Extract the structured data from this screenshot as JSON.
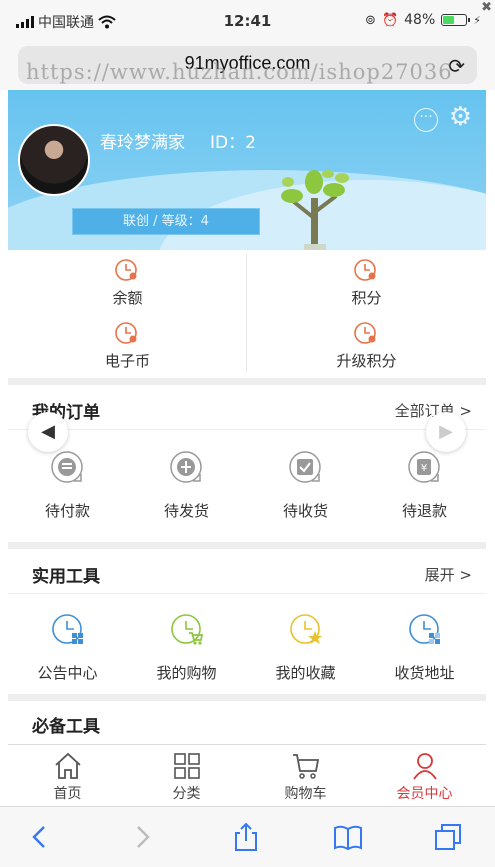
{
  "status_bar": {
    "carrier": "中国联通",
    "time": "12:41",
    "battery_percent": "48%",
    "battery_level": 0.48
  },
  "browser": {
    "url": "91myoffice.com",
    "watermark": "https://www.huzhan.com/ishop27036"
  },
  "profile": {
    "username": "春玲梦满家",
    "id_text": "ID：2",
    "level_text": "联创 / 等级：4"
  },
  "assets": [
    {
      "label": "余额",
      "icon": "clock-icon"
    },
    {
      "label": "积分",
      "icon": "clock-icon"
    },
    {
      "label": "电子币",
      "icon": "clock-icon"
    },
    {
      "label": "升级积分",
      "icon": "clock-icon"
    }
  ],
  "orders": {
    "title": "我的订单",
    "link": "全部订单 >",
    "items": [
      {
        "label": "待付款",
        "icon": "coins-icon"
      },
      {
        "label": "待发货",
        "icon": "gift-icon"
      },
      {
        "label": "待收货",
        "icon": "check-box-icon"
      },
      {
        "label": "待退款",
        "icon": "yen-icon"
      }
    ]
  },
  "tools": {
    "title": "实用工具",
    "link": "展开 >",
    "items": [
      {
        "label": "公告中心",
        "icon": "announcement-icon"
      },
      {
        "label": "我的购物",
        "icon": "shopping-icon"
      },
      {
        "label": "我的收藏",
        "icon": "favorite-icon"
      },
      {
        "label": "收货地址",
        "icon": "address-icon"
      }
    ]
  },
  "essentials": {
    "title": "必备工具"
  },
  "tab_bar": [
    {
      "label": "首页",
      "icon": "home-icon"
    },
    {
      "label": "分类",
      "icon": "grid-icon"
    },
    {
      "label": "购物车",
      "icon": "cart-icon"
    },
    {
      "label": "会员中心",
      "icon": "user-icon",
      "active": true
    }
  ],
  "colors": {
    "banner": "#66c3ef",
    "accent_red": "#d9383a",
    "asset_icon": "#e8734a",
    "tool_blue": "#3d8fd6",
    "tool_green": "#8cc63f",
    "tool_yellow": "#e8c22e"
  }
}
